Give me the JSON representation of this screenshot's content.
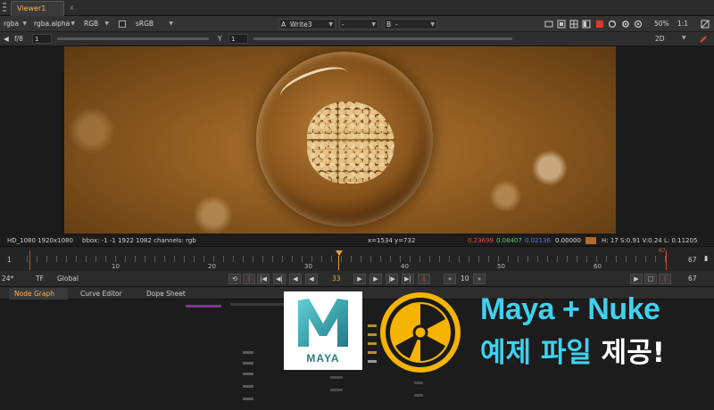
{
  "viewer": {
    "tab_label": "Viewer1",
    "tab_close": "x",
    "channels": "rgba",
    "alpha": "rgba.alpha",
    "color": "RGB",
    "colorspace": "sRGB",
    "input_a_label": "A",
    "input_a": "Write3",
    "input_a2": "-",
    "input_b_label": "B",
    "input_b": "-",
    "zoom": "50%",
    "ratio": "1:1",
    "gain_label": "f/8",
    "gain_value": "1",
    "gamma_label": "Y",
    "gamma_value": "1",
    "view_mode": "2D"
  },
  "info_bar": {
    "format": "HD_1080 1920x1080",
    "bbox": "bbox: -1 -1 1922 1082 channels: rgb",
    "coords": "x=1534 y=732",
    "r": "0.23699",
    "g": "0.08407",
    "b": "0.02136",
    "a": "0.00000",
    "hsvl": "H: 17 S:0.91 V:0.24  L: 0.11205"
  },
  "timeline": {
    "start": "1",
    "end": "67",
    "end2": "67",
    "ticks": [
      "10",
      "20",
      "30",
      "40",
      "50",
      "60"
    ],
    "current_marker": "33"
  },
  "transport": {
    "fps": "24*",
    "tf": "TF",
    "scope": "Global",
    "current_frame": "33",
    "step": "10",
    "end_frame": "67"
  },
  "node_graph": {
    "tabs": [
      "Node Graph",
      "Curve Editor",
      "Dope Sheet"
    ]
  },
  "promo": {
    "maya_text": "MAYA",
    "line1": "Maya + Nuke",
    "line2_colored": "예제 파일",
    "line2_white": "제공!"
  },
  "colors": {
    "accent": "#3fd1ee",
    "nuke_yellow": "#f4b400",
    "maya_teal": "#2a7e8a",
    "viewer_tab": "#ffb14a"
  }
}
